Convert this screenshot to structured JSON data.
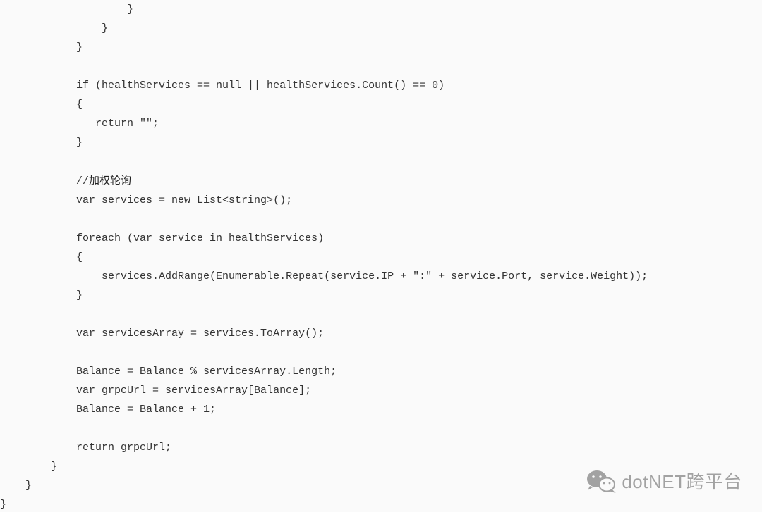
{
  "code": {
    "lines": [
      "                    }",
      "                }",
      "            }",
      "",
      "            if (healthServices == null || healthServices.Count() == 0)",
      "            {",
      "               return \"\";",
      "            }",
      "",
      "            //",
      "            var services = new List<string>();",
      "",
      "            foreach (var service in healthServices)",
      "            {",
      "                services.AddRange(Enumerable.Repeat(service.IP + \":\" + service.Port, service.Weight));",
      "            }",
      "",
      "            var servicesArray = services.ToArray();",
      "",
      "            Balance = Balance % servicesArray.Length;",
      "            var grpcUrl = servicesArray[Balance];",
      "            Balance = Balance + 1;",
      "",
      "            return grpcUrl;",
      "        }",
      "    }",
      "}"
    ],
    "comment_cn": "加权轮询"
  },
  "watermark": {
    "text": "dotNET跨平台",
    "icon": "wechat-icon"
  }
}
